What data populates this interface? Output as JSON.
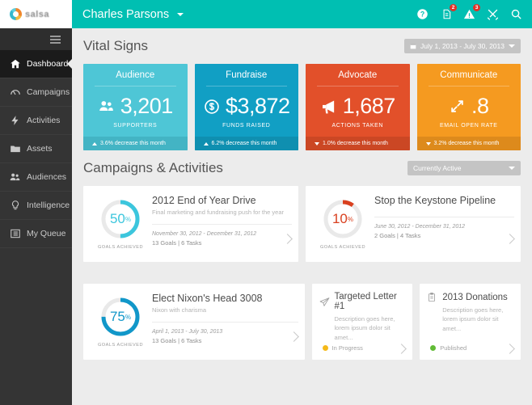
{
  "brand": {
    "name": "salsa",
    "logo_icon": "salsa-circle-logo"
  },
  "sidebar": {
    "menu_icon": "hamburger-menu-icon",
    "items": [
      {
        "label": "Dashboard",
        "icon": "home-icon",
        "active": true
      },
      {
        "label": "Campaigns",
        "icon": "speedometer-icon",
        "active": false
      },
      {
        "label": "Activities",
        "icon": "lightning-icon",
        "active": false
      },
      {
        "label": "Assets",
        "icon": "folder-icon",
        "active": false
      },
      {
        "label": "Audiences",
        "icon": "people-icon",
        "active": false
      },
      {
        "label": "Intelligence",
        "icon": "lightbulb-icon",
        "active": false
      },
      {
        "label": "My Queue",
        "icon": "list-icon",
        "active": false
      }
    ]
  },
  "topbar": {
    "user": "Charles Parsons",
    "dropdown_icon": "chevron-down-icon",
    "actions": [
      {
        "icon": "help-icon",
        "badge": null
      },
      {
        "icon": "document-icon",
        "badge": "2"
      },
      {
        "icon": "alert-icon",
        "badge": "3"
      },
      {
        "icon": "tools-icon",
        "badge": null
      },
      {
        "icon": "search-icon",
        "badge": null
      }
    ],
    "accent": "#00bfb2"
  },
  "vital_signs": {
    "title": "Vital Signs",
    "date_range": "July 1, 2013 - July 30, 2013",
    "calendar_icon": "calendar-icon",
    "dropdown_icon": "caret-down-icon",
    "cards": [
      {
        "title": "Audience",
        "value": "3,201",
        "unit": "SUPPORTERS",
        "icon": "people-icon",
        "footer": "3.6% decrease this month",
        "trend": "up",
        "color": "#4ec6d6",
        "footer_color": "#43b4c4"
      },
      {
        "title": "Fundraise",
        "value": "$3,872",
        "unit": "FUNDS RAISED",
        "icon": "dollar-circle-icon",
        "footer": "6.2% decrease this month",
        "trend": "up",
        "color": "#119fc4",
        "footer_color": "#0f8fb0"
      },
      {
        "title": "Advocate",
        "value": "1,687",
        "unit": "ACTIONS TAKEN",
        "icon": "megaphone-icon",
        "footer": "1.0% decrease this month",
        "trend": "down",
        "color": "#e2502a",
        "footer_color": "#cb4724"
      },
      {
        "title": "Communicate",
        "value": ".8",
        "unit": "EMAIL OPEN RATE",
        "icon": "expand-arrows-icon",
        "footer": "3.2% decrease this month",
        "trend": "down",
        "color": "#f59a20",
        "footer_color": "#dd8a1c"
      }
    ]
  },
  "campaigns": {
    "title": "Campaigns & Activities",
    "filter": "Currently Active",
    "filter_icon": "caret-down-icon",
    "chevron_icon": "chevron-right-icon",
    "items": [
      {
        "kind": "campaign",
        "name": "2012 End of Year Drive",
        "description": "Final marketing and fundraising push for the year",
        "dates": "November 30, 2012 - December 31, 2012",
        "meta": "13 Goals  |  6 Tasks",
        "percent": 50,
        "percent_label": "50",
        "percent_symbol": "%",
        "goals_caption": "GOALS ACHIEVED",
        "ring_color": "#3cc6dd",
        "track_color": "#e9e9e9"
      },
      {
        "kind": "campaign",
        "name": "Stop the Keystone Pipeline",
        "description": "",
        "dates": "June 30, 2012 - December 31, 2012",
        "meta": "2 Goals  |  4 Tasks",
        "percent": 10,
        "percent_label": "10",
        "percent_symbol": "%",
        "goals_caption": "GOALS ACHIEVED",
        "ring_color": "#d9401f",
        "track_color": "#e9e9e9"
      },
      {
        "kind": "campaign",
        "name": "Elect Nixon's Head 3008",
        "description": "Nixon with charisma",
        "dates": "April 1, 2013 - July 30, 2013",
        "meta": "13 Goals  |  6 Tasks",
        "percent": 75,
        "percent_label": "75",
        "percent_symbol": "%",
        "goals_caption": "GOALS ACHIEVED",
        "ring_color": "#1197c9",
        "track_color": "#e9e9e9"
      }
    ],
    "activities": [
      {
        "kind": "activity",
        "name": "Targeted Letter #1",
        "icon": "paper-plane-icon",
        "description": "Description goes here, lorem ipsum dolor sit amet...",
        "status": "In Progress",
        "status_color": "#f5b919"
      },
      {
        "kind": "activity",
        "name": "2013 Donations",
        "icon": "clipboard-icon",
        "description": "Description goes here, lorem ipsum dolor sit amet...",
        "status": "Published",
        "status_color": "#61bb36"
      }
    ]
  }
}
